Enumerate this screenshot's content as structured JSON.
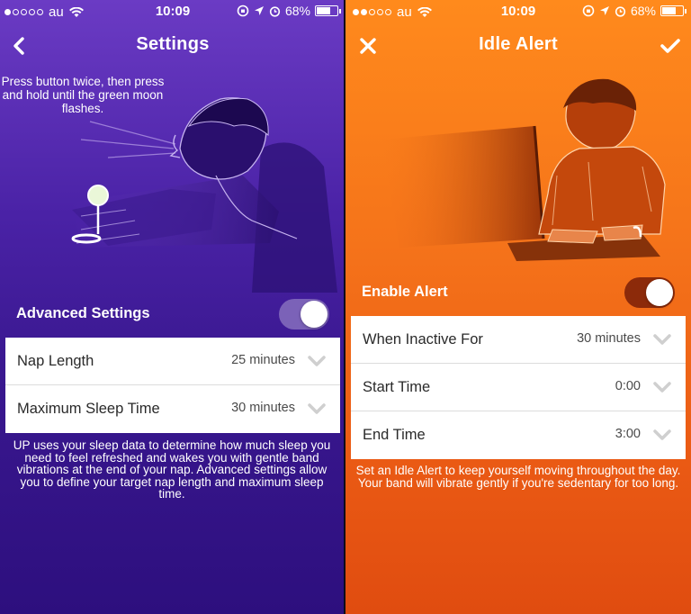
{
  "left_screen": {
    "status": {
      "carrier": "au",
      "time": "10:09",
      "battery": "68%",
      "battery_level": 0.68
    },
    "nav": {
      "title": "Settings",
      "back_icon": "chevron-left-icon"
    },
    "instruction": "Press button twice, then press and hold until the green moon flashes.",
    "advanced": {
      "label": "Advanced Settings",
      "enabled": true
    },
    "rows": [
      {
        "label": "Nap Length",
        "value": "25 minutes"
      },
      {
        "label": "Maximum Sleep Time",
        "value": "30 minutes"
      }
    ],
    "footnote": "UP uses your sleep data to determine how much sleep you need to feel refreshed and wakes you with gentle band vibrations at the end of your nap. Advanced settings allow you to define your target nap length and maximum sleep time.",
    "colors": {
      "background": "#4a22a6"
    }
  },
  "right_screen": {
    "status": {
      "carrier": "au",
      "time": "10:09",
      "battery": "68%",
      "battery_level": 0.68
    },
    "nav": {
      "title": "Idle Alert",
      "close_icon": "close-icon",
      "confirm_icon": "checkmark-icon"
    },
    "enable": {
      "label": "Enable Alert",
      "enabled": true
    },
    "rows": [
      {
        "label": "When Inactive For",
        "value": "30 minutes"
      },
      {
        "label": "Start Time",
        "value": "0:00"
      },
      {
        "label": "End Time",
        "value": "3:00"
      }
    ],
    "footnote": "Set an Idle Alert to keep yourself moving throughout the day. Your band will vibrate gently if you're sedentary for too long.",
    "colors": {
      "background": "#f5731a"
    }
  }
}
